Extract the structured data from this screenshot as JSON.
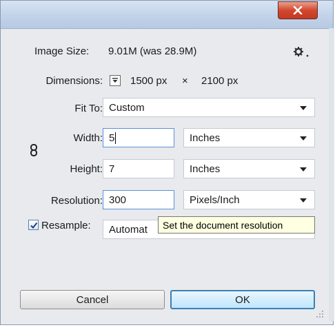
{
  "titlebar": {
    "close_label": "x"
  },
  "image_size": {
    "label": "Image Size:",
    "value": "9.01M (was 28.9M)"
  },
  "dimensions": {
    "label": "Dimensions:",
    "width_value": "1500 px",
    "times": "×",
    "height_value": "2100 px"
  },
  "fit_to": {
    "label": "Fit To:",
    "value": "Custom"
  },
  "width": {
    "label": "Width:",
    "value": "5",
    "unit": "Inches"
  },
  "height": {
    "label": "Height:",
    "value": "7",
    "unit": "Inches"
  },
  "resolution": {
    "label": "Resolution:",
    "value": "300",
    "unit": "Pixels/Inch"
  },
  "resample": {
    "label": "Resample:",
    "value": "Automat",
    "checked": true
  },
  "tooltip": {
    "text": "Set the document resolution"
  },
  "buttons": {
    "cancel": "Cancel",
    "ok": "OK"
  },
  "icons": {
    "gear": "gear-icon",
    "chain": "chain-link-icon",
    "dims_toggle": "dropdown-toggle-icon"
  }
}
